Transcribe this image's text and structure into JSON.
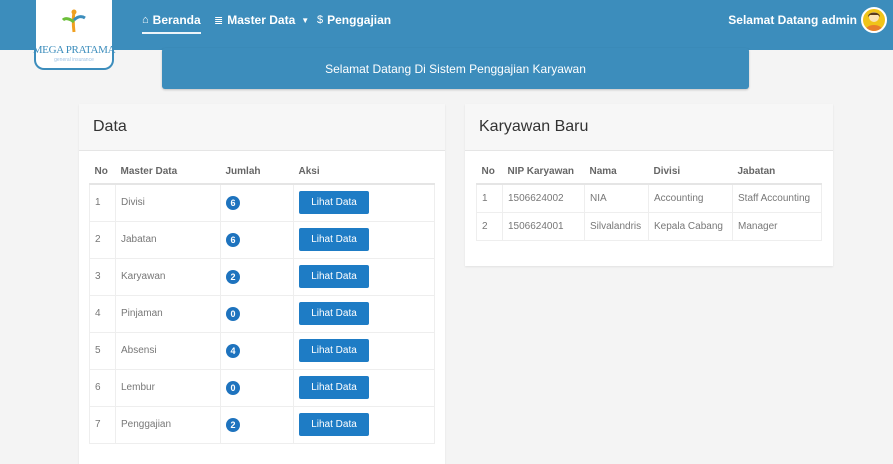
{
  "brand": {
    "name": "MEGA PRATAMA",
    "tagline": "general insurance"
  },
  "nav": [
    {
      "icon": "home-icon",
      "label": "Beranda",
      "glyph": "⌂"
    },
    {
      "icon": "database-icon",
      "label": "Master Data",
      "glyph": "≣"
    },
    {
      "icon": "dollar-icon",
      "label": "Penggajian",
      "glyph": "$"
    }
  ],
  "user": {
    "greeting": "Selamat Datang admin"
  },
  "banner": {
    "text": "Selamat Datang Di Sistem Penggajian Karyawan"
  },
  "data_panel": {
    "title": "Data",
    "headers": [
      "No",
      "Master Data",
      "Jumlah",
      "Aksi"
    ],
    "button_label": "Lihat Data",
    "rows": [
      {
        "no": "1",
        "name": "Divisi",
        "count": "6"
      },
      {
        "no": "2",
        "name": "Jabatan",
        "count": "6"
      },
      {
        "no": "3",
        "name": "Karyawan",
        "count": "2"
      },
      {
        "no": "4",
        "name": "Pinjaman",
        "count": "0"
      },
      {
        "no": "5",
        "name": "Absensi",
        "count": "4"
      },
      {
        "no": "6",
        "name": "Lembur",
        "count": "0"
      },
      {
        "no": "7",
        "name": "Penggajian",
        "count": "2"
      }
    ]
  },
  "karyawan_panel": {
    "title": "Karyawan Baru",
    "headers": [
      "No",
      "NIP Karyawan",
      "Nama",
      "Divisi",
      "Jabatan"
    ],
    "rows": [
      {
        "no": "1",
        "nip": "1506624002",
        "nama": "NIA",
        "divisi": "Accounting",
        "jabatan": "Staff Accounting"
      },
      {
        "no": "2",
        "nip": "1506624001",
        "nama": "Silvalandris",
        "divisi": "Kepala Cabang",
        "jabatan": "Manager"
      }
    ]
  },
  "colors": {
    "primary": "#3c8dbc",
    "button": "#1e7cc5",
    "badge": "#1e73be",
    "background": "#f4f4f4"
  }
}
